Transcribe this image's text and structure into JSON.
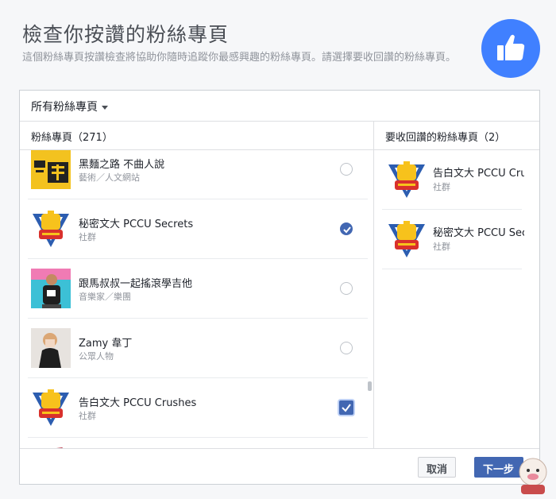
{
  "header": {
    "title": "檢查你按讚的粉絲專頁",
    "description": "這個粉絲專頁按讚檢查將協助你隨時追蹤你最感興趣的粉絲專頁。請選擇要收回讚的粉絲專頁。"
  },
  "filter": {
    "label": "所有粉絲專頁"
  },
  "left_column": {
    "header": "粉絲專頁（271）",
    "pages": [
      {
        "name": "黑麵之路 不曲人說",
        "category": "藝術／人文網站",
        "selected": false
      },
      {
        "name": "秘密文大 PCCU Secrets",
        "category": "社群",
        "selected": true
      },
      {
        "name": "跟馬叔叔一起搖滾學吉他",
        "category": "音樂家／樂團",
        "selected": false
      },
      {
        "name": "Zamy 韋丁",
        "category": "公眾人物",
        "selected": false
      },
      {
        "name": "告白文大 PCCU Crushes",
        "category": "社群",
        "selected": true
      }
    ]
  },
  "right_column": {
    "header": "要收回讚的粉絲專頁（2）",
    "pages": [
      {
        "name": "告白文大 PCCU Crushes",
        "category": "社群"
      },
      {
        "name": "秘密文大 PCCU Secrets",
        "category": "社群"
      }
    ]
  },
  "footer": {
    "cancel_label": "取消",
    "next_label": "下一步"
  },
  "colors": {
    "facebook_blue": "#4267b2",
    "like_badge": "#4080ff",
    "crest_yellow": "#f7c21c",
    "crest_blue": "#2c5db0",
    "crest_red": "#d9312c"
  }
}
